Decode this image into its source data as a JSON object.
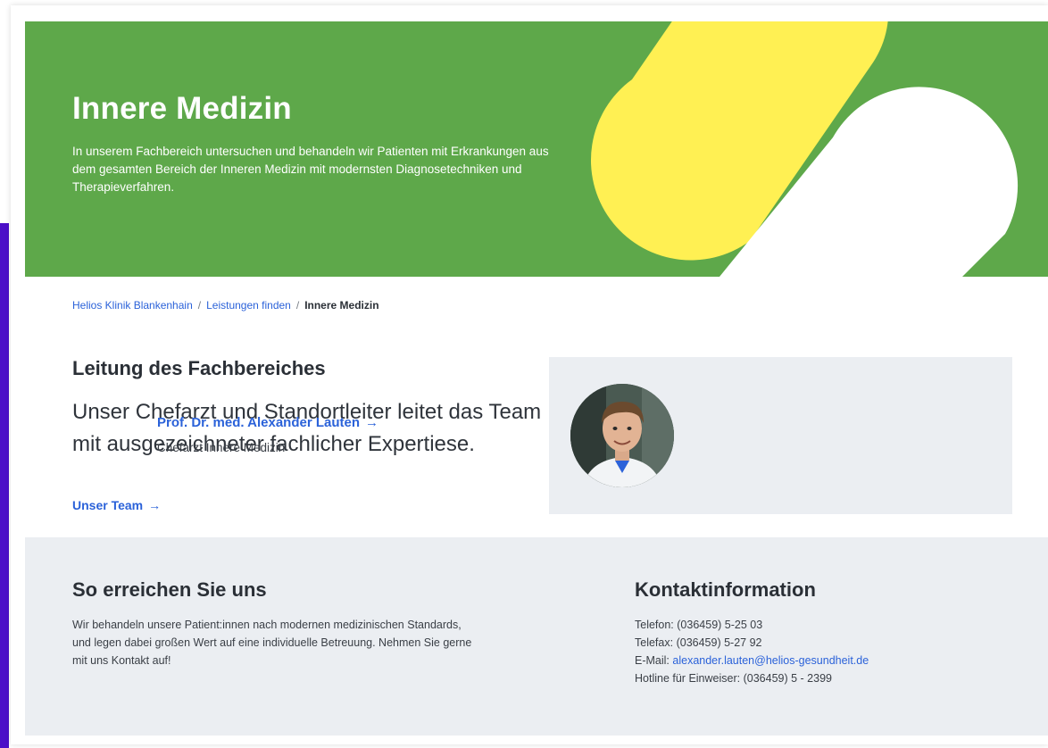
{
  "hero": {
    "title": "Innere Medizin",
    "description": "In unserem Fachbereich untersuchen und behandeln wir Patienten mit Erkrankungen aus dem gesamten Bereich der Inneren Medizin mit modernsten Diagnosetechniken und Therapieverfahren.",
    "colors": {
      "background": "#5ea84a",
      "shape_yellow": "#fff053",
      "shape_white": "#ffffff"
    }
  },
  "breadcrumb": {
    "items": [
      "Helios Klinik Blankenhain",
      "Leistungen finden"
    ],
    "separator": "/",
    "current": "Innere Medizin"
  },
  "leadership": {
    "title": "Leitung des Fachbereiches",
    "text": "Unser Chefarzt und Standortleiter leitet das Team mit ausgezeichneter fachlicher Expertiese.",
    "team_link": "Unser Team",
    "arrow": "→",
    "doctor": {
      "name": "Prof. Dr. med. Alexander Lauten",
      "role": "Chefarzt Innere Medizin"
    }
  },
  "reach": {
    "title": "So erreichen Sie uns",
    "text": "Wir behandeln unsere Patient:innen nach modernen medizinischen Standards, und legen dabei großen Wert auf eine individuelle Betreuung. Nehmen Sie gerne mit uns Kontakt auf!"
  },
  "contact": {
    "title": "Kontaktinformation",
    "phone_label": "Telefon:",
    "phone": "(036459) 5-25 03",
    "fax_label": "Telefax:",
    "fax": "(036459) 5-27 92",
    "email_label": "E-Mail:",
    "email": "alexander.lauten@helios-gesundheit.de",
    "hotline_label": "Hotline für Einweiser:",
    "hotline": "(036459) 5 - 2399"
  },
  "accent_color": "#2b62d9"
}
